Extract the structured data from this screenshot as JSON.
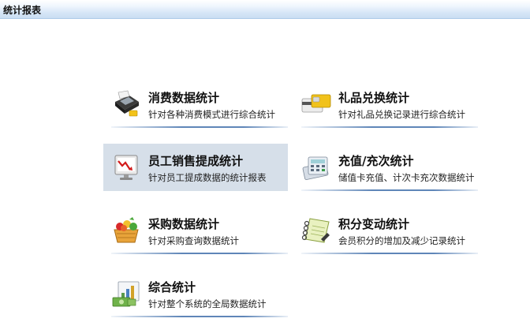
{
  "header": {
    "title": "统计报表"
  },
  "tiles": [
    {
      "label": "消费数据统计",
      "desc": "针对各种消费模式进行综合统计",
      "icon": "pos-terminal-icon"
    },
    {
      "label": "礼品兑换统计",
      "desc": "针对礼品兑换记录进行综合统计",
      "icon": "gift-card-icon"
    },
    {
      "label": "员工销售提成统计",
      "desc": "针对员工提成数据的统计报表",
      "icon": "monitor-chart-icon"
    },
    {
      "label": "充值/充次统计",
      "desc": "储值卡充值、计次卡充次数据统计",
      "icon": "calculator-icon"
    },
    {
      "label": "采购数据统计",
      "desc": "针对采购查询数据统计",
      "icon": "shopping-basket-icon"
    },
    {
      "label": "积分变动统计",
      "desc": "会员积分的增加及减少记录统计",
      "icon": "notebook-icon"
    },
    {
      "label": "综合统计",
      "desc": "针对整个系统的全局数据统计",
      "icon": "money-chart-icon"
    }
  ]
}
